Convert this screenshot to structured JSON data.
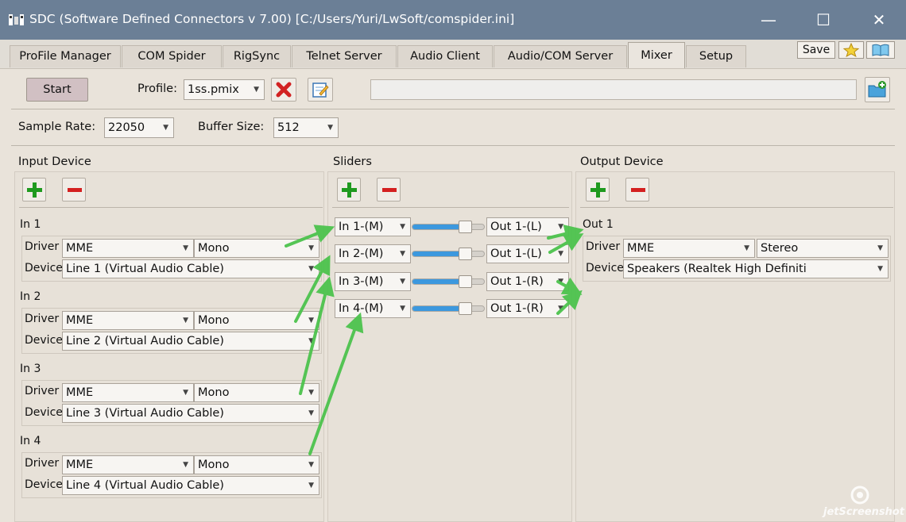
{
  "window": {
    "title": "SDC (Software Defined Connectors v 7.00) [C:/Users/Yuri/LwSoft/comspider.ini]",
    "minimize": "—",
    "maximize": "☐",
    "close": "✕"
  },
  "tabs": [
    "ProFile Manager",
    "COM Spider",
    "RigSync",
    "Telnet Server",
    "Audio Client",
    "Audio/COM Server",
    "Mixer",
    "Setup"
  ],
  "active_tab": "Mixer",
  "tab_right": {
    "save_label": "Save"
  },
  "toolbar": {
    "start_label": "Start",
    "profile_label": "Profile:",
    "profile_value": "1ss.pmix",
    "path_value": ""
  },
  "settings": {
    "sample_rate_label": "Sample Rate:",
    "sample_rate_value": "22050",
    "buffer_size_label": "Buffer Size:",
    "buffer_size_value": "512"
  },
  "input": {
    "heading": "Input Device",
    "devices": [
      {
        "name": "In 1",
        "driver_label": "Driver",
        "driver": "MME",
        "channel": "Mono",
        "device_label": "Device",
        "device": "Line 1 (Virtual Audio Cable)"
      },
      {
        "name": "In 2",
        "driver_label": "Driver",
        "driver": "MME",
        "channel": "Mono",
        "device_label": "Device",
        "device": "Line 2 (Virtual Audio Cable)"
      },
      {
        "name": "In 3",
        "driver_label": "Driver",
        "driver": "MME",
        "channel": "Mono",
        "device_label": "Device",
        "device": "Line 3 (Virtual Audio Cable)"
      },
      {
        "name": "In 4",
        "driver_label": "Driver",
        "driver": "MME",
        "channel": "Mono",
        "device_label": "Device",
        "device": "Line 4 (Virtual Audio Cable)"
      }
    ]
  },
  "sliders": {
    "heading": "Sliders",
    "rows": [
      {
        "source": "In 1-(M)",
        "level": 0.8,
        "target": "Out 1-(L)"
      },
      {
        "source": "In 2-(M)",
        "level": 0.8,
        "target": "Out 1-(L)"
      },
      {
        "source": "In 3-(M)",
        "level": 0.8,
        "target": "Out 1-(R)"
      },
      {
        "source": "In 4-(M)",
        "level": 0.8,
        "target": "Out 1-(R)"
      }
    ]
  },
  "output": {
    "heading": "Output Device",
    "devices": [
      {
        "name": "Out 1",
        "driver_label": "Driver",
        "driver": "MME",
        "channel": "Stereo",
        "device_label": "Device",
        "device": "Speakers (Realtek High Definiti"
      }
    ]
  },
  "watermark": "jetScreenshot",
  "colors": {
    "titlebar": "#6b7f96",
    "accent_green": "#1f9a1f",
    "accent_red": "#d42020",
    "slider_fill": "#3c98de",
    "arrow": "#4dc34d"
  }
}
